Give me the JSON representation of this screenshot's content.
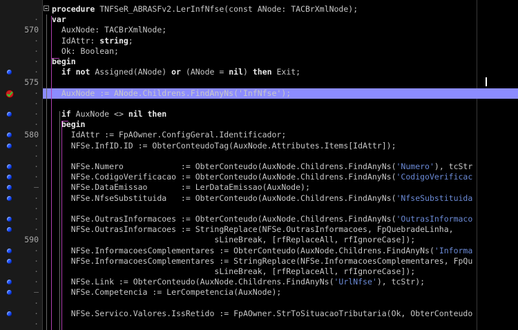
{
  "editor": {
    "caret_line": 6,
    "lines": [
      {
        "num": "",
        "bp": false,
        "fold": true,
        "tokens": [
          [
            "k",
            "procedure "
          ],
          [
            "t",
            "TNFSeR_ABRASFv2.LerInfNfse(const ANode: TACBrXmlNode);"
          ]
        ]
      },
      {
        "num": "·",
        "bp": false,
        "tokens": [
          [
            "k",
            "var"
          ]
        ]
      },
      {
        "num": "570",
        "bp": false,
        "tokens": [
          [
            "t",
            "  AuxNode: TACBrXmlNode;"
          ]
        ]
      },
      {
        "num": "·",
        "bp": false,
        "tokens": [
          [
            "t",
            "  IdAttr: "
          ],
          [
            "k",
            "string"
          ],
          [
            "t",
            ";"
          ]
        ]
      },
      {
        "num": "·",
        "bp": false,
        "tokens": [
          [
            "t",
            "  Ok: Boolean;"
          ]
        ]
      },
      {
        "num": "·",
        "bp": false,
        "tokens": [
          [
            "k",
            "begin"
          ]
        ]
      },
      {
        "num": "·",
        "bp": true,
        "tokens": [
          [
            "t",
            "  "
          ],
          [
            "k",
            "if not "
          ],
          [
            "t",
            "Assigned(ANode) "
          ],
          [
            "k",
            "or "
          ],
          [
            "t",
            "(ANode = "
          ],
          [
            "k",
            "nil"
          ],
          [
            "t",
            ") "
          ],
          [
            "k",
            "then "
          ],
          [
            "t",
            "Exit;"
          ]
        ]
      },
      {
        "num": "575",
        "bp": false,
        "tokens": []
      },
      {
        "num": "·",
        "bp": false,
        "exec": true,
        "selected": true,
        "tokens": [
          [
            "t",
            "  AuxNode := ANode.Childrens.FindAnyNs('InfNfse');"
          ]
        ]
      },
      {
        "num": "·",
        "bp": false,
        "tokens": []
      },
      {
        "num": "·",
        "bp": true,
        "tokens": [
          [
            "t",
            "  "
          ],
          [
            "k",
            "if "
          ],
          [
            "t",
            "AuxNode <> "
          ],
          [
            "k",
            "nil then"
          ]
        ]
      },
      {
        "num": "·",
        "bp": false,
        "tokens": [
          [
            "t",
            "  "
          ],
          [
            "k",
            "begin"
          ]
        ]
      },
      {
        "num": "580",
        "bp": true,
        "tokens": [
          [
            "t",
            "    IdAttr := FpAOwner.ConfigGeral.Identificador;"
          ]
        ]
      },
      {
        "num": "·",
        "bp": true,
        "tokens": [
          [
            "t",
            "    NFSe.InfID.ID := ObterConteudoTag(AuxNode.Attributes.Items[IdAttr]);"
          ]
        ]
      },
      {
        "num": "·",
        "bp": false,
        "tokens": []
      },
      {
        "num": "·",
        "bp": true,
        "tokens": [
          [
            "t",
            "    NFSe.Numero            := ObterConteudo(AuxNode.Childrens.FindAnyNs("
          ],
          [
            "s",
            "'Numero'"
          ],
          [
            "t",
            "), tcStr"
          ]
        ]
      },
      {
        "num": "·",
        "bp": true,
        "tokens": [
          [
            "t",
            "    NFSe.CodigoVerificacao := ObterConteudo(AuxNode.Childrens.FindAnyNs("
          ],
          [
            "s",
            "'CodigoVerificac"
          ]
        ]
      },
      {
        "num": "–",
        "bp": true,
        "tokens": [
          [
            "t",
            "    NFSe.DataEmissao       := LerDataEmissao(AuxNode);"
          ]
        ]
      },
      {
        "num": "·",
        "bp": true,
        "tokens": [
          [
            "t",
            "    NFSe.NfseSubstituida   := ObterConteudo(AuxNode.Childrens.FindAnyNs("
          ],
          [
            "s",
            "'NfseSubstituida"
          ]
        ]
      },
      {
        "num": "·",
        "bp": false,
        "tokens": []
      },
      {
        "num": "·",
        "bp": true,
        "tokens": [
          [
            "t",
            "    NFSe.OutrasInformacoes := ObterConteudo(AuxNode.Childrens.FindAnyNs("
          ],
          [
            "s",
            "'OutrasInformaco"
          ]
        ]
      },
      {
        "num": "·",
        "bp": true,
        "tokens": [
          [
            "t",
            "    NFSe.OutrasInformacoes := StringReplace(NFSe.OutrasInformacoes, FpQuebradeLinha,"
          ]
        ]
      },
      {
        "num": "590",
        "bp": false,
        "tokens": [
          [
            "t",
            "                                  sLineBreak, [rfReplaceAll, rfIgnoreCase]);"
          ]
        ]
      },
      {
        "num": "·",
        "bp": true,
        "tokens": [
          [
            "t",
            "    NFSe.InformacoesComplementares := ObterConteudo(AuxNode.Childrens.FindAnyNs("
          ],
          [
            "s",
            "'Informa"
          ]
        ]
      },
      {
        "num": "·",
        "bp": true,
        "tokens": [
          [
            "t",
            "    NFSe.InformacoesComplementares := StringReplace(NFSe.InformacoesComplementares, FpQu"
          ]
        ]
      },
      {
        "num": "·",
        "bp": false,
        "tokens": [
          [
            "t",
            "                                  sLineBreak, [rfReplaceAll, rfIgnoreCase]);"
          ]
        ]
      },
      {
        "num": "·",
        "bp": true,
        "tokens": [
          [
            "t",
            "    NFSe.Link := ObterConteudo(AuxNode.Childrens.FindAnyNs("
          ],
          [
            "s",
            "'UrlNfse'"
          ],
          [
            "t",
            "), tcStr);"
          ]
        ]
      },
      {
        "num": "–",
        "bp": true,
        "tokens": [
          [
            "t",
            "    NFSe.Competencia := LerCompetencia(AuxNode);"
          ]
        ]
      },
      {
        "num": "·",
        "bp": false,
        "tokens": []
      },
      {
        "num": "·",
        "bp": true,
        "tokens": [
          [
            "t",
            "    NFSe.Servico.Valores.IssRetido := FpAOwner.StrToSituacaoTributaria(Ok, ObterConteudo"
          ]
        ]
      },
      {
        "num": "·",
        "bp": false,
        "tokens": []
      }
    ]
  }
}
